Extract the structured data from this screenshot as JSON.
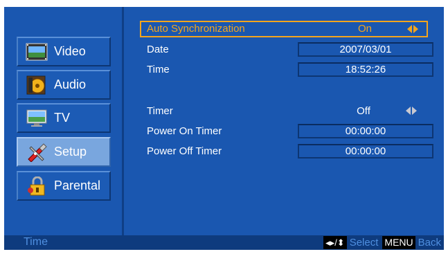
{
  "sidebar": {
    "items": [
      {
        "label": "Video",
        "icon": "video-icon",
        "active": false
      },
      {
        "label": "Audio",
        "icon": "audio-icon",
        "active": false
      },
      {
        "label": "TV",
        "icon": "tv-icon",
        "active": false
      },
      {
        "label": "Setup",
        "icon": "setup-icon",
        "active": true
      },
      {
        "label": "Parental",
        "icon": "parental-lock-icon",
        "active": false
      }
    ]
  },
  "settings": {
    "auto_sync": {
      "label": "Auto Synchronization",
      "value": "On"
    },
    "date": {
      "label": "Date",
      "value": "2007/03/01"
    },
    "time": {
      "label": "Time",
      "value": "18:52:26"
    },
    "timer": {
      "label": "Timer",
      "value": "Off"
    },
    "power_on_timer": {
      "label": "Power On Timer",
      "value": "00:00:00"
    },
    "power_off_timer": {
      "label": "Power Off Timer",
      "value": "00:00:00"
    }
  },
  "footer": {
    "title": "Time",
    "select_keys": "◂▸/⬍",
    "select_label": "Select",
    "menu_key": "MENU",
    "back_label": "Back"
  },
  "colors": {
    "background": "#1a57b0",
    "highlight": "#f3a51d",
    "footer": "#0e3b7e",
    "active_item": "#79a6de"
  }
}
